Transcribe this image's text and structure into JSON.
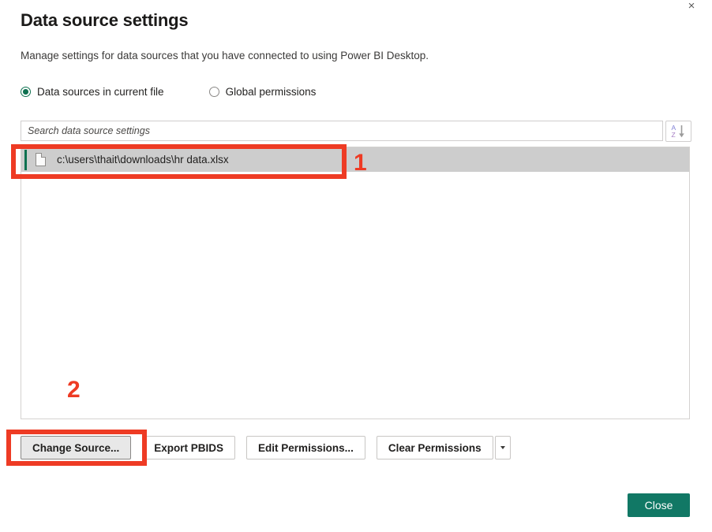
{
  "dialog": {
    "title": "Data source settings",
    "subtitle": "Manage settings for data sources that you have connected to using Power BI Desktop.",
    "close_icon": "close-x-icon",
    "close_glyph": "×"
  },
  "scope_options": [
    {
      "label": "Data sources in current file",
      "selected": true
    },
    {
      "label": "Global permissions",
      "selected": false
    }
  ],
  "search": {
    "placeholder": "Search data source settings",
    "value": "",
    "sort_button": {
      "icon": "sort-az-icon",
      "top_letter": "A",
      "bottom_letter": "Z"
    }
  },
  "list": {
    "items": [
      {
        "label": "c:\\users\\thait\\downloads\\hr data.xlsx",
        "icon": "document-icon",
        "selected": true
      }
    ]
  },
  "actions": [
    {
      "label": "Change Source...",
      "style": "pressed"
    },
    {
      "label": "Export PBIDS",
      "style": "default"
    },
    {
      "label": "Edit Permissions...",
      "style": "default"
    },
    {
      "label": "Clear Permissions",
      "style": "split"
    }
  ],
  "footer": {
    "close_label": "Close"
  },
  "annotations": [
    {
      "number": "1",
      "target": "selected data source row"
    },
    {
      "number": "2",
      "target": "Change Source... button"
    }
  ],
  "colors": {
    "accent_teal": "#0e7150",
    "close_button": "#117865",
    "annotation_red": "#ee3b24",
    "selection_grey": "#cdcdcd"
  }
}
